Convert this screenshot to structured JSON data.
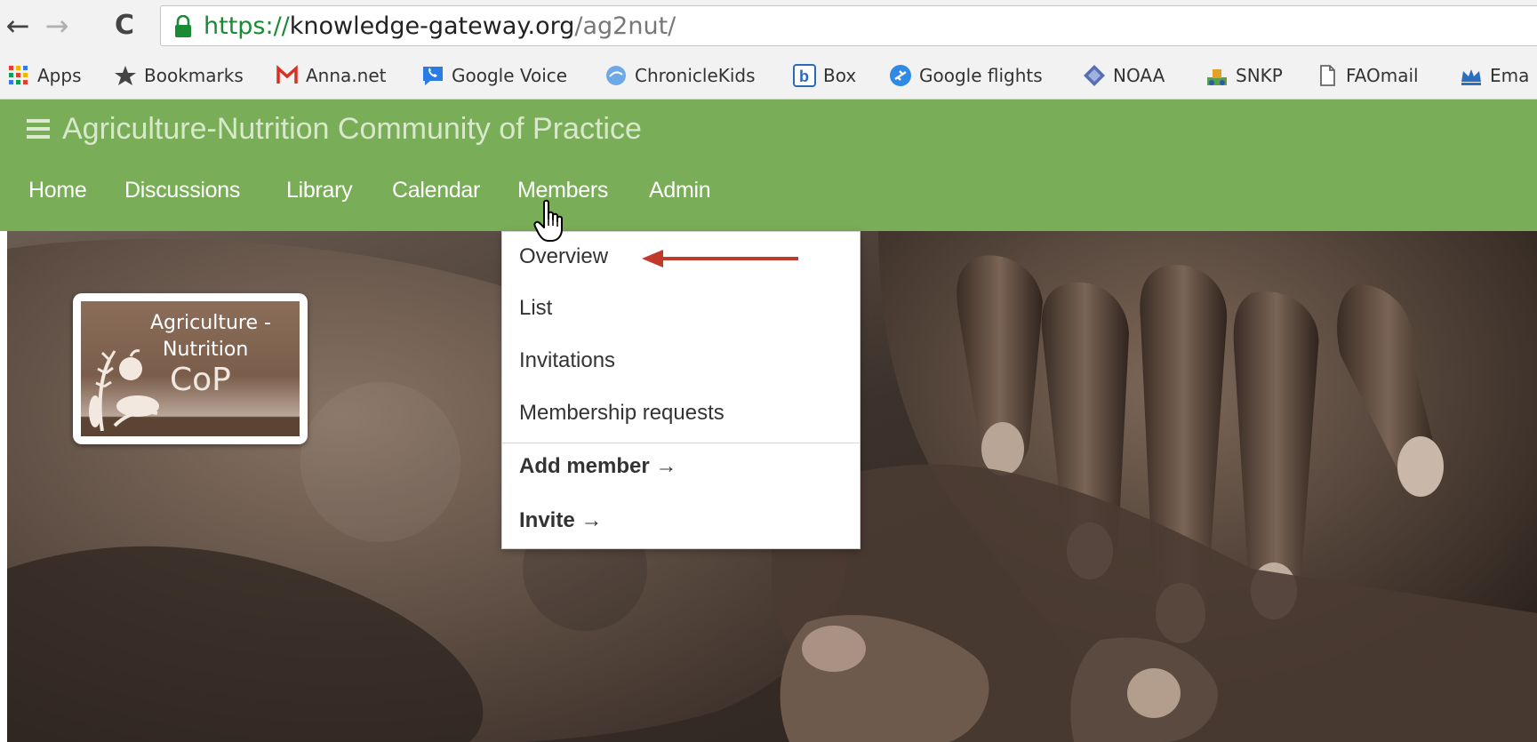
{
  "browser": {
    "url": {
      "scheme": "https://",
      "host": "knowledge-gateway.org",
      "path": "/ag2nut/"
    },
    "bookmarks": [
      {
        "label": "Apps",
        "icon": "apps-grid-icon"
      },
      {
        "label": "Bookmarks",
        "icon": "star-icon"
      },
      {
        "label": "Anna.net",
        "icon": "gmail-icon"
      },
      {
        "label": "Google Voice",
        "icon": "phone-icon"
      },
      {
        "label": "ChronicleKids",
        "icon": "globe-icon"
      },
      {
        "label": "Box",
        "icon": "box-icon"
      },
      {
        "label": "Google flights",
        "icon": "flight-icon"
      },
      {
        "label": "NOAA",
        "icon": "diamond-icon"
      },
      {
        "label": "SNKP",
        "icon": "farm-icon"
      },
      {
        "label": "FAOmail",
        "icon": "document-icon"
      },
      {
        "label": "Ema",
        "icon": "crown-icon"
      }
    ]
  },
  "site": {
    "title": "Agriculture-Nutrition Community of Practice",
    "nav": [
      "Home",
      "Discussions",
      "Library",
      "Calendar",
      "Members",
      "Admin"
    ]
  },
  "logo": {
    "line1": "Agriculture -",
    "line2": "Nutrition",
    "line3": "CoP"
  },
  "members_menu": {
    "items": [
      "Overview",
      "List",
      "Invitations",
      "Membership requests"
    ],
    "actions": [
      "Add member →",
      "Invite →"
    ]
  },
  "colors": {
    "header_green": "#7aad57",
    "annotation_red": "#c0392b"
  }
}
